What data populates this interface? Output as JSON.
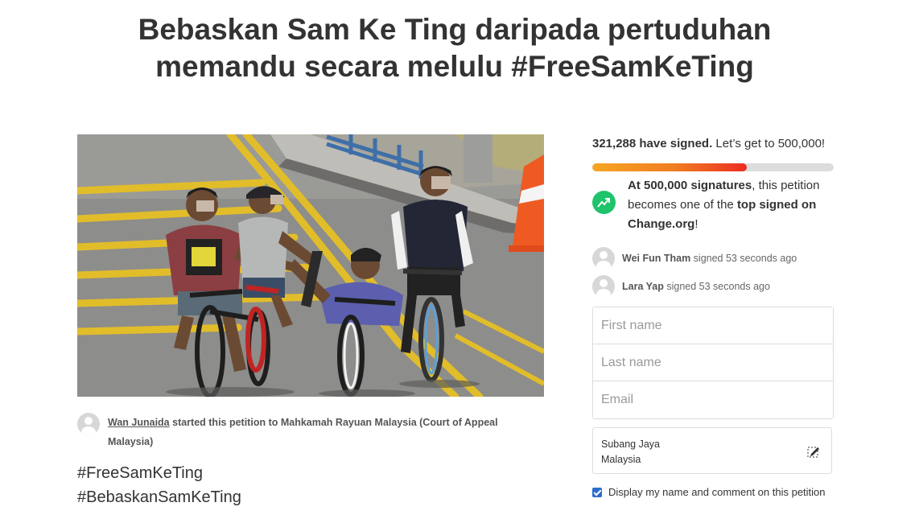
{
  "petition": {
    "title_line1": "Bebaskan Sam Ke Ting daripada pertuduhan",
    "title_line2": "memandu secara melulu #FreeSamKeTing",
    "image_alt": "Children riding bicycles on a road",
    "starter_name": "Wan Junaida",
    "starter_text": " started this petition to Mahkamah Rayuan Malaysia (Court of Appeal Malaysia)",
    "hashtag1": "#FreeSamKeTing",
    "hashtag2": "#BebaskanSamKeTing"
  },
  "signatures": {
    "count_bold": "321,288 have signed.",
    "count_rest": " Let’s get to 500,000!",
    "progress_fraction": 0.64,
    "goal_bold": "At 500,000 signatures",
    "goal_mid": ", this petition becomes one of the ",
    "goal_top": "top signed on Change.org",
    "goal_end": "!",
    "trend_icon": "trending-up-icon",
    "accent": "#1ec36b",
    "progress_colors": [
      "#f5a623",
      "#ec2c22"
    ]
  },
  "recent": [
    {
      "name": "Wei Fun Tham",
      "action": " signed 53 seconds ago"
    },
    {
      "name": "Lara Yap",
      "action": " signed 53 seconds ago"
    }
  ],
  "form": {
    "first_name_placeholder": "First name",
    "last_name_placeholder": "Last name",
    "email_placeholder": "Email",
    "city": "Subang Jaya",
    "country": "Malaysia",
    "display_label": "Display my name and comment on this petition",
    "display_checked": true
  }
}
